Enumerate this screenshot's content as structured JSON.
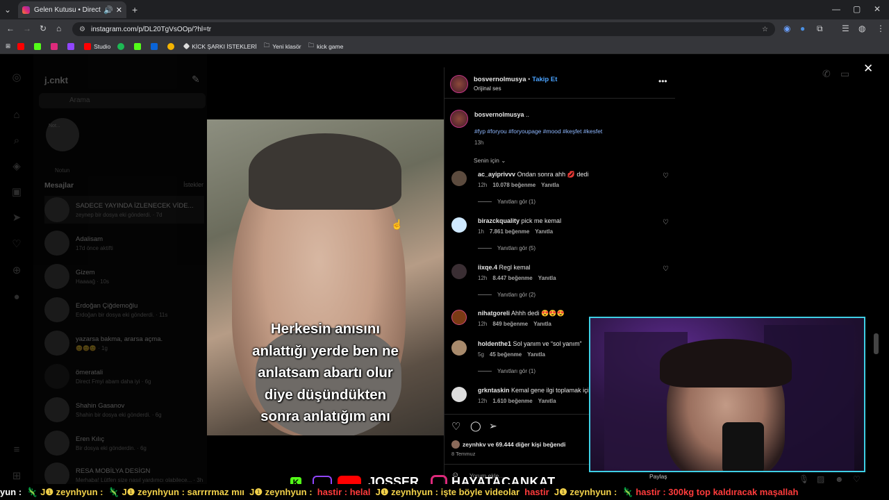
{
  "browser": {
    "tab_title": "Gelen Kutusu • Direct",
    "url": "instagram.com/p/DL20TgVsOOp/?hl=tr",
    "bookmarks": [
      "Studio",
      "KİCK ŞARKI İSTEKLERİ",
      "Yeni klasör",
      "kick game"
    ]
  },
  "dm": {
    "username": "j.cnkt",
    "search_placeholder": "Arama",
    "note_placeholder": "Not...",
    "note_label": "Notun",
    "messages_header": "Mesajlar",
    "requests_label": "İstekler",
    "threads": [
      {
        "name": "SADECE YAYINDA İZLENECEK VİDE...",
        "sub": "zeynep bir dosya eki gönderdi. · 7d"
      },
      {
        "name": "Adalisam",
        "sub": "17d önce aktifti"
      },
      {
        "name": "Gizem",
        "sub": "Haaaağ · 10s"
      },
      {
        "name": "Erdoğan Çiğdemoğlu",
        "sub": "Erdoğan bir dosya eki gönderdi. · 11s"
      },
      {
        "name": "yazarsa bakma, ararsa açma.",
        "sub": "😊😊😊 · 1g"
      },
      {
        "name": "ömeratali",
        "sub": "Direct Fmyi abam daha iyi · 6g"
      },
      {
        "name": "Shahin Gasanov",
        "sub": "Shahin bir dosya eki gönderdi. · 6g"
      },
      {
        "name": "Eren Kılıç",
        "sub": "Bir dosya eki gönderdin. · 6g"
      },
      {
        "name": "RESA MOBİLYA DESİGN",
        "sub": "Merhaba! Lütfen size nasıl yardımcı olabilece... · 3h"
      }
    ]
  },
  "video": {
    "caption": [
      "Herkesin anısını",
      "anlattığı yerde ben ne",
      "anlatsam abartı olur",
      "diye düşündükten",
      "sonra anlatığım anı"
    ]
  },
  "post": {
    "author": "bosvernolmusya",
    "follow": "Takip Et",
    "audio": "Orijinal ses",
    "caption_user": "bosvernolmusya",
    "caption_text": "..",
    "hashtags": "#fyp #foryou #foryoupage #mood #keşfet #kesfet",
    "caption_time": "13h",
    "sort_label": "Senin için",
    "reply_label": "Yanıtla",
    "comments": [
      {
        "user": "ac_ayiprivvv",
        "text": "Ondan sonra ahh 💋 dedi",
        "time": "12h",
        "likes": "10.078 beğenme",
        "replies": "Yanıtları gör (1)"
      },
      {
        "user": "birazckquality",
        "text": "pick me kemal",
        "time": "1h",
        "likes": "7.861 beğenme",
        "replies": "Yanıtları gör (5)"
      },
      {
        "user": "iixqe.4",
        "text": "Regl kemal",
        "time": "12h",
        "likes": "8.447 beğenme",
        "replies": "Yanıtları gör (2)"
      },
      {
        "user": "nihatgoreli",
        "text": "Ahhh dedi 😍😍😍",
        "time": "12h",
        "likes": "849 beğenme",
        "replies": ""
      },
      {
        "user": "holdenthe1",
        "text": "Sol yanım ve “sol yanım”",
        "time": "5g",
        "likes": "45 beğenme",
        "replies": "Yanıtları gör (1)"
      },
      {
        "user": "grkntaskin",
        "text": "Kemal gene ilgi toplamak için",
        "time": "12h",
        "likes": "1.610 beğenme",
        "replies": ""
      }
    ],
    "liked_by": "zeynhkv ve 69.444 diğer kişi beğendi",
    "date": "8 Temmuz",
    "add_comment": "Yorum ekle...",
    "share": "Paylaş"
  },
  "stream": {
    "brand": "HAYATACANKAT",
    "logo_text": "JOSSER",
    "ticker": [
      {
        "t": "yun :",
        "c": ""
      },
      {
        "t": "🦎 J❶ zeynhyun :",
        "c": "y"
      },
      {
        "t": "🦎 J❶ zeynhyun : sarrrrmaz mıı",
        "c": "y"
      },
      {
        "t": "J❶ zeynhyun :",
        "c": "y"
      },
      {
        "t": "hastir : helal",
        "c": "r"
      },
      {
        "t": "J❶ zeynhyun : işte böyle videolar",
        "c": "y"
      },
      {
        "t": "hastir",
        "c": "r"
      },
      {
        "t": "J❶ zeynhyun :",
        "c": "y"
      },
      {
        "t": "🦎 hastir : 300kg top kaldıracak maşallah",
        "c": "r"
      }
    ]
  }
}
